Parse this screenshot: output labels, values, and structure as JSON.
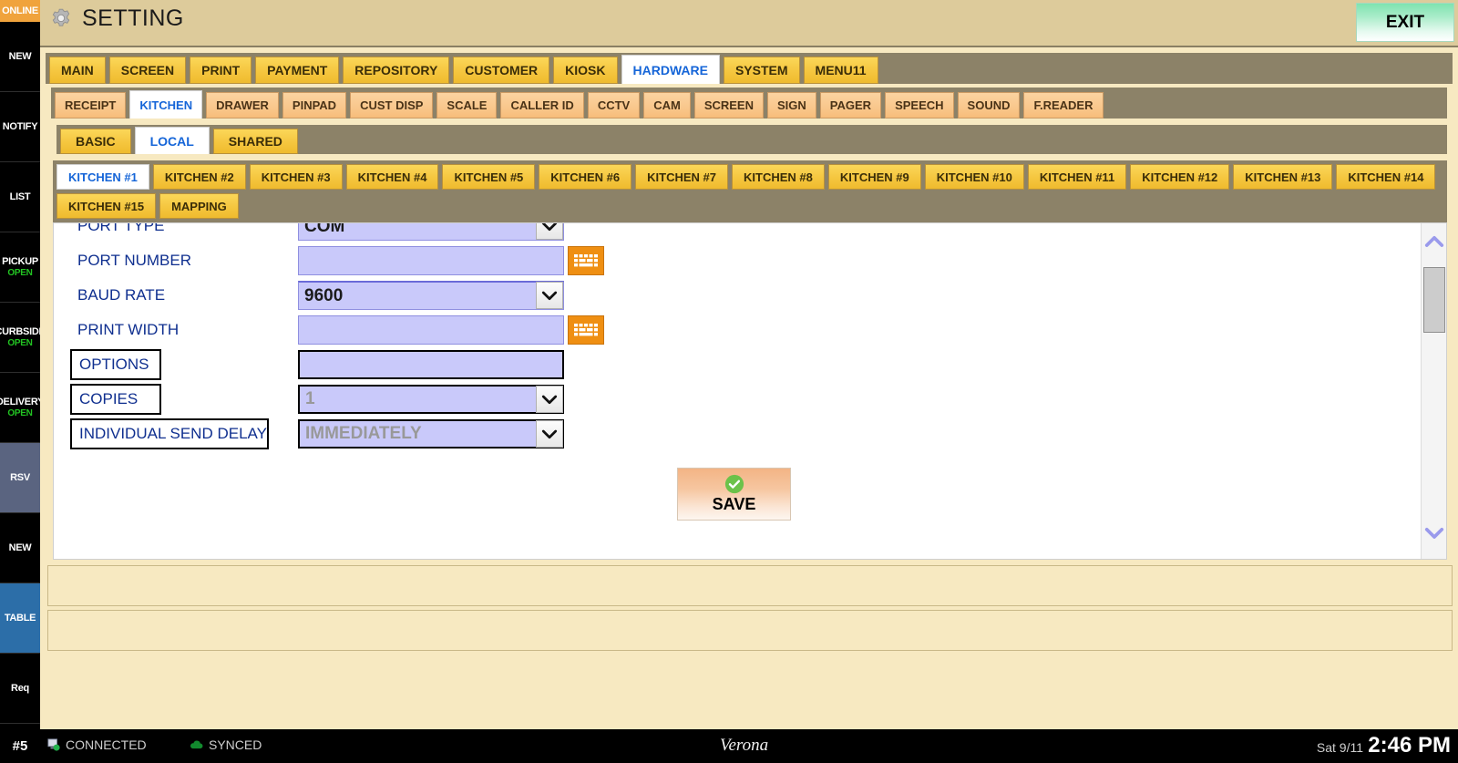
{
  "header": {
    "title": "SETTING",
    "gear_icon": "gear-icon",
    "exit_label": "EXIT"
  },
  "sidebar": {
    "status_badge": "ONLINE",
    "items": [
      {
        "label": "NEW",
        "sub": "",
        "style": "plain"
      },
      {
        "label": "NOTIFY",
        "sub": "",
        "style": "plain"
      },
      {
        "label": "LIST",
        "sub": "",
        "style": "plain"
      },
      {
        "label": "PICKUP",
        "sub": "OPEN",
        "style": "plain"
      },
      {
        "label": "CURBSIDE",
        "sub": "OPEN",
        "style": "plain"
      },
      {
        "label": "DELIVERY",
        "sub": "OPEN",
        "style": "plain"
      },
      {
        "label": "RSV",
        "sub": "",
        "style": "rsv"
      },
      {
        "label": "NEW",
        "sub": "",
        "style": "plain"
      },
      {
        "label": "TABLE",
        "sub": "",
        "style": "table"
      },
      {
        "label": "Req",
        "sub": "",
        "style": "plain"
      }
    ]
  },
  "tabs_main": [
    {
      "label": "MAIN",
      "active": false
    },
    {
      "label": "SCREEN",
      "active": false
    },
    {
      "label": "PRINT",
      "active": false
    },
    {
      "label": "PAYMENT",
      "active": false
    },
    {
      "label": "REPOSITORY",
      "active": false
    },
    {
      "label": "CUSTOMER",
      "active": false
    },
    {
      "label": "KIOSK",
      "active": false
    },
    {
      "label": "HARDWARE",
      "active": true
    },
    {
      "label": "SYSTEM",
      "active": false
    },
    {
      "label": "MENU11",
      "active": false
    }
  ],
  "tabs_device": [
    {
      "label": "RECEIPT",
      "active": false
    },
    {
      "label": "KITCHEN",
      "active": true
    },
    {
      "label": "DRAWER",
      "active": false
    },
    {
      "label": "PINPAD",
      "active": false
    },
    {
      "label": "CUST DISP",
      "active": false
    },
    {
      "label": "SCALE",
      "active": false
    },
    {
      "label": "CALLER ID",
      "active": false
    },
    {
      "label": "CCTV",
      "active": false
    },
    {
      "label": "CAM",
      "active": false
    },
    {
      "label": "SCREEN",
      "active": false
    },
    {
      "label": "SIGN",
      "active": false
    },
    {
      "label": "PAGER",
      "active": false
    },
    {
      "label": "SPEECH",
      "active": false
    },
    {
      "label": "SOUND",
      "active": false
    },
    {
      "label": "F.READER",
      "active": false
    }
  ],
  "tabs_scope": [
    {
      "label": "BASIC",
      "active": false
    },
    {
      "label": "LOCAL",
      "active": true
    },
    {
      "label": "SHARED",
      "active": false
    }
  ],
  "tabs_kitchen": [
    {
      "label": "KITCHEN #1",
      "active": true
    },
    {
      "label": "KITCHEN #2",
      "active": false
    },
    {
      "label": "KITCHEN #3",
      "active": false
    },
    {
      "label": "KITCHEN #4",
      "active": false
    },
    {
      "label": "KITCHEN #5",
      "active": false
    },
    {
      "label": "KITCHEN #6",
      "active": false
    },
    {
      "label": "KITCHEN #7",
      "active": false
    },
    {
      "label": "KITCHEN #8",
      "active": false
    },
    {
      "label": "KITCHEN #9",
      "active": false
    },
    {
      "label": "KITCHEN #10",
      "active": false
    },
    {
      "label": "KITCHEN #11",
      "active": false
    },
    {
      "label": "KITCHEN #12",
      "active": false
    },
    {
      "label": "KITCHEN #13",
      "active": false
    },
    {
      "label": "KITCHEN #14",
      "active": false
    },
    {
      "label": "KITCHEN #15",
      "active": false
    },
    {
      "label": "MAPPING",
      "active": false
    }
  ],
  "form": {
    "fields": [
      {
        "name": "port-type",
        "label": "PORT TYPE",
        "value": "COM",
        "control": "select",
        "boxed_label": false,
        "muted": false,
        "keyboard": false
      },
      {
        "name": "port-number",
        "label": "PORT NUMBER",
        "value": "",
        "control": "text",
        "boxed_label": false,
        "muted": false,
        "keyboard": true
      },
      {
        "name": "baud-rate",
        "label": "BAUD RATE",
        "value": "9600",
        "control": "select",
        "boxed_label": false,
        "muted": false,
        "keyboard": false
      },
      {
        "name": "print-width",
        "label": "PRINT WIDTH",
        "value": "",
        "control": "text",
        "boxed_label": false,
        "muted": false,
        "keyboard": true
      },
      {
        "name": "options",
        "label": "OPTIONS",
        "value": "",
        "control": "text",
        "boxed_label": true,
        "muted": false,
        "keyboard": false
      },
      {
        "name": "copies",
        "label": "COPIES",
        "value": "1",
        "control": "select",
        "boxed_label": true,
        "muted": true,
        "keyboard": false
      },
      {
        "name": "individual-send-delay",
        "label": "INDIVIDUAL SEND DELAY",
        "value": "IMMEDIATELY",
        "control": "select",
        "boxed_label": true,
        "muted": true,
        "keyboard": false
      }
    ],
    "save_label": "SAVE"
  },
  "statusbar": {
    "terminal": "#5",
    "connection": "CONNECTED",
    "sync": "SYNCED",
    "brand": "Verona",
    "date": "Sat 9/11",
    "time": "2:46 PM"
  },
  "colors": {
    "accent_blue": "#1565d8",
    "tab_yellow": "#f5c63f",
    "tab_orange": "#f9c78c",
    "field_purple": "#c9c9fa",
    "exit_green": "#7fe3b0",
    "online_orange": "#f0a33c",
    "status_green": "#22c322"
  }
}
